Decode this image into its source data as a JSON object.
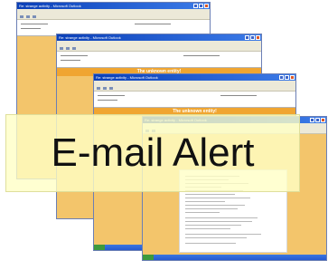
{
  "window_stack": [
    {
      "title": "Re: strange activity - Microsoft Outlook",
      "banner": ""
    },
    {
      "title": "Re: strange activity - Microsoft Outlook",
      "banner": "The unknown entity!"
    },
    {
      "title": "Re: strange activity - Microsoft Outlook",
      "banner": "The unknown entity!"
    },
    {
      "title": "Re: strange activity - Microsoft Outlook",
      "banner": ""
    }
  ],
  "alert_label": "E-mail Alert",
  "colors": {
    "window_bg": "#f3c56b",
    "banner": "#f0a531",
    "titlebar": "#0a3fb8",
    "alert_box": "#ffffc6"
  }
}
